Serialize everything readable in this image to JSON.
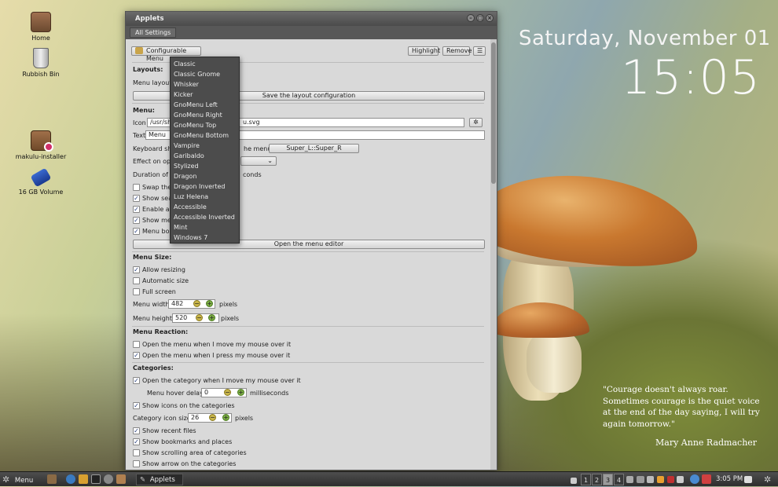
{
  "desktop": {
    "icons": [
      {
        "label": "Home"
      },
      {
        "label": "Rubbish Bin"
      },
      {
        "label": "makulu-installer"
      },
      {
        "label": "16 GB Volume"
      }
    ],
    "date": "Saturday, November 01",
    "time": "15:05",
    "quote": "\"Courage doesn't always roar. Sometimes courage is the quiet voice at the end of the day saying, I will try again tomorrow.\"",
    "quote_author": "Mary Anne Radmacher"
  },
  "window": {
    "title": "Applets",
    "tab": "All Settings",
    "applet_name": "Configurable Menu",
    "highlight_label": "Highlight",
    "remove_label": "Remove",
    "sections": {
      "layouts": "Layouts:",
      "menu": "Menu:",
      "menu_size": "Menu Size:",
      "menu_reaction": "Menu Reaction:",
      "categories": "Categories:"
    },
    "menu_layout_label": "Menu layout:",
    "save_layout_label": "Save the layout configuration",
    "icon_label": "Icon",
    "icon_value_left": "/usr/sha",
    "icon_value_right": "u.svg",
    "text_label": "Text",
    "text_value": "Menu",
    "shortcut_label_left": "Keyboard sho",
    "shortcut_label_right": "he menu",
    "shortcut_value": "Super_L::Super_R",
    "effect_label": "Effect on ope",
    "duration_label_left": "Duration of e",
    "duration_label_right": "conds",
    "checks_partial": [
      {
        "label": "Swap the",
        "checked": false
      },
      {
        "label": "Show sea",
        "checked": true
      },
      {
        "label": "Enable au",
        "checked": true
      },
      {
        "label": "Show men",
        "checked": true
      },
      {
        "label": "Menu bord",
        "checked": true
      }
    ],
    "open_editor_label": "Open the menu editor",
    "size_checks": [
      {
        "label": "Allow resizing",
        "checked": true
      },
      {
        "label": "Automatic size",
        "checked": false
      },
      {
        "label": "Full screen",
        "checked": false
      }
    ],
    "menu_width_label": "Menu width:",
    "menu_width_value": "482",
    "menu_height_label": "Menu height:",
    "menu_height_value": "520",
    "pixels_label": "pixels",
    "reaction_checks": [
      {
        "label": "Open the menu when I move my mouse over it",
        "checked": false
      },
      {
        "label": "Open the menu when I press my mouse over it",
        "checked": true
      }
    ],
    "cat_check_open": {
      "label": "Open the category when I move my mouse over it",
      "checked": true
    },
    "hover_delay_label": "Menu hover delay:",
    "hover_delay_value": "0",
    "milliseconds_label": "milliseconds",
    "cat_check_icons": {
      "label": "Show icons on the categories",
      "checked": true
    },
    "cat_icon_size_label": "Category icon size:",
    "cat_icon_size_value": "26",
    "bottom_checks": [
      {
        "label": "Show recent files",
        "checked": true
      },
      {
        "label": "Show bookmarks and places",
        "checked": true
      },
      {
        "label": "Show scrolling area of categories",
        "checked": false
      },
      {
        "label": "Show arrow on the categories",
        "checked": false
      }
    ]
  },
  "layout_dropdown": {
    "options": [
      "Classic",
      "Classic Gnome",
      "Whisker",
      "Kicker",
      "GnoMenu Left",
      "GnoMenu Right",
      "GnoMenu Top",
      "GnoMenu Bottom",
      "Vampire",
      "Garibaldo",
      "Stylized",
      "Dragon",
      "Dragon Inverted",
      "Luz Helena",
      "Accessible",
      "Accessible Inverted",
      "Mint",
      "Windows 7"
    ]
  },
  "taskbar": {
    "menu_label": "Menu",
    "task_label": "Applets",
    "workspaces": [
      "1",
      "2",
      "3",
      "4"
    ],
    "active_workspace": "3",
    "clock": "3:05 PM"
  }
}
